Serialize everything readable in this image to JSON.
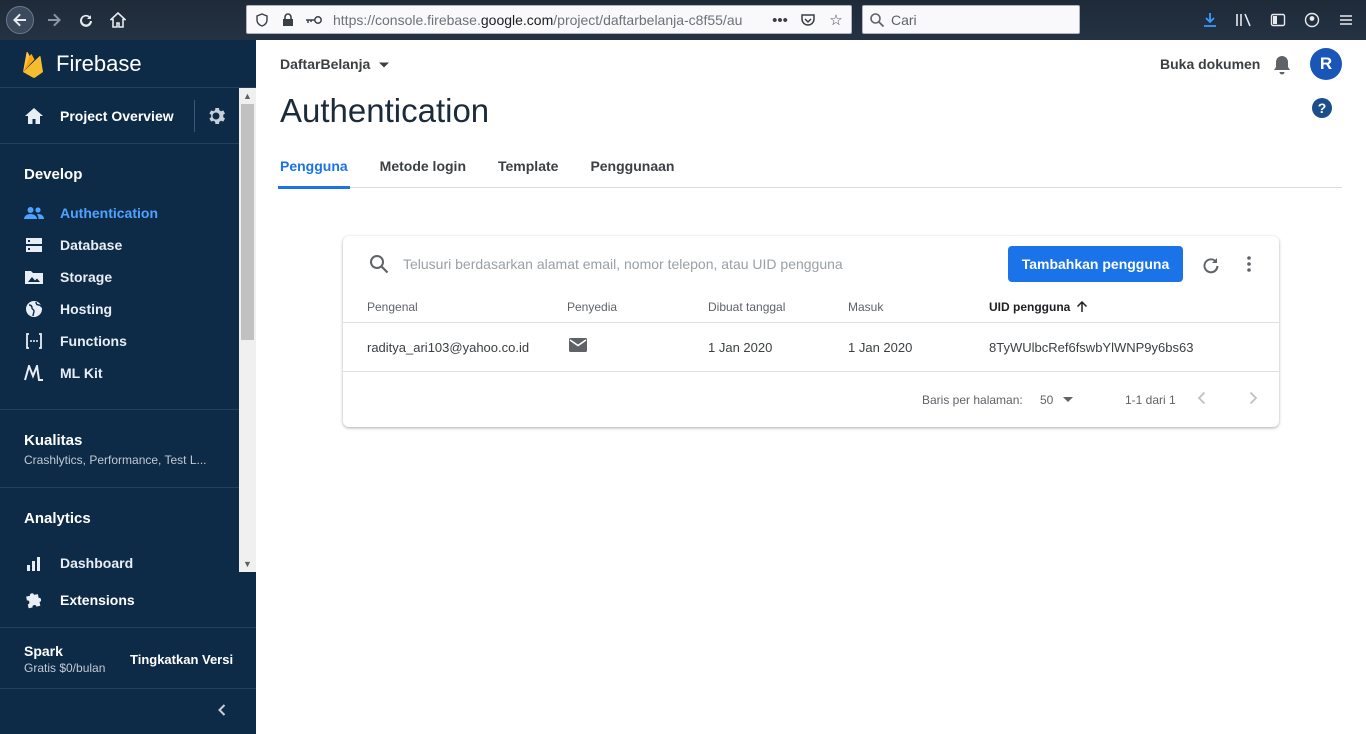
{
  "browser": {
    "url_prefix": "https://console.firebase.",
    "url_domain": "google.com",
    "url_rest": "/project/daftarbelanja-c8f55/au",
    "search_placeholder": "Cari"
  },
  "sidebar": {
    "brand": "Firebase",
    "overview_label": "Project Overview",
    "develop_title": "Develop",
    "develop_items": [
      {
        "label": "Authentication"
      },
      {
        "label": "Database"
      },
      {
        "label": "Storage"
      },
      {
        "label": "Hosting"
      },
      {
        "label": "Functions"
      },
      {
        "label": "ML Kit"
      }
    ],
    "quality_title": "Kualitas",
    "quality_sub": "Crashlytics, Performance, Test L...",
    "analytics_title": "Analytics",
    "analytics_items": [
      {
        "label": "Dashboard"
      }
    ],
    "extensions_label": "Extensions",
    "plan_name": "Spark",
    "plan_price": "Gratis $0/bulan",
    "upgrade_label": "Tingkatkan Versi"
  },
  "header": {
    "project": "DaftarBelanja",
    "docs_link": "Buka dokumen",
    "avatar_letter": "R"
  },
  "page": {
    "title": "Authentication",
    "tabs": [
      "Pengguna",
      "Metode login",
      "Template",
      "Penggunaan"
    ]
  },
  "users_card": {
    "search_placeholder": "Telusuri berdasarkan alamat email, nomor telepon, atau UID pengguna",
    "add_button": "Tambahkan pengguna",
    "columns": [
      "Pengenal",
      "Penyedia",
      "Dibuat tanggal",
      "Masuk",
      "UID pengguna"
    ],
    "rows": [
      {
        "identifier": "raditya_ari103@yahoo.co.id",
        "provider_icon": "email-icon",
        "created": "1 Jan 2020",
        "signed_in": "1 Jan 2020",
        "uid": "8TyWUlbcRef6fswbYlWNP9y6bs63"
      }
    ],
    "rows_per_page_label": "Baris per halaman:",
    "rows_per_page": "50",
    "range": "1-1 dari 1"
  },
  "colors": {
    "sidebar_bg": "#0d2a47",
    "accent": "#1a73e8",
    "active_nav": "#4fa3ff"
  }
}
